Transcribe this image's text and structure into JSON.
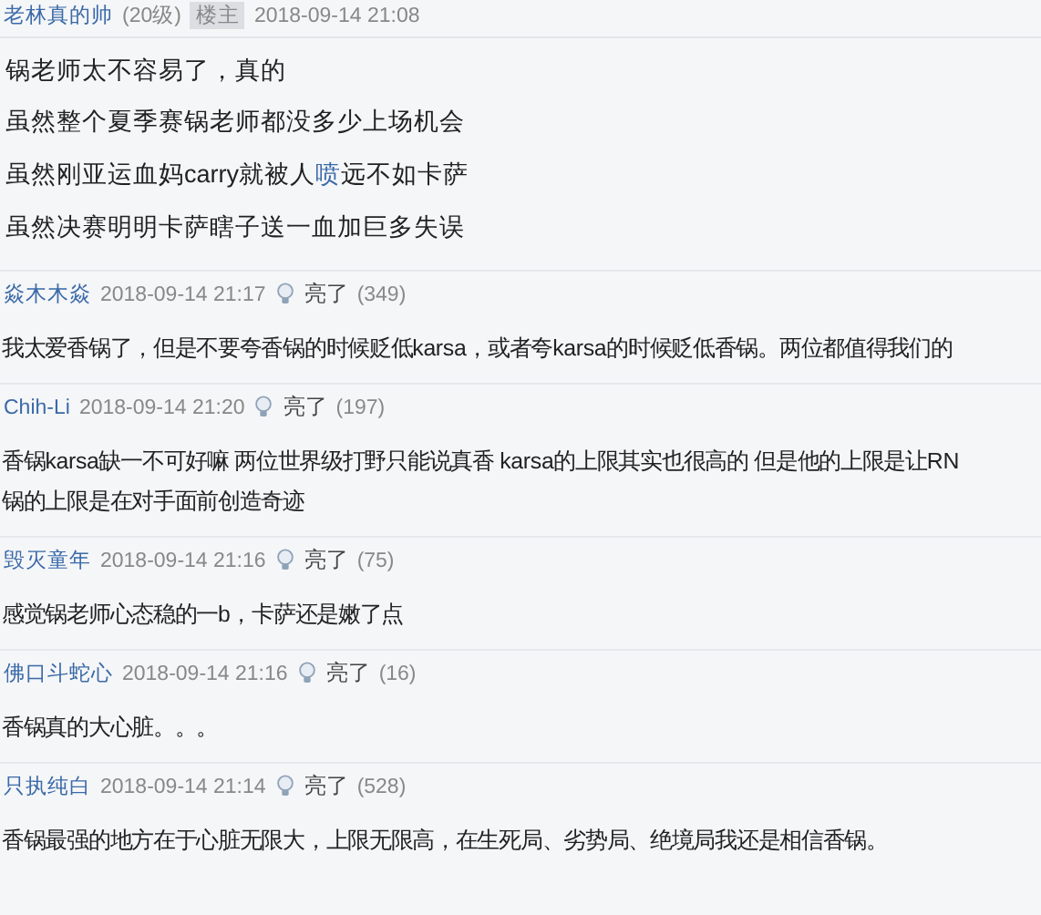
{
  "main_post": {
    "author": "老林真的帅",
    "level": "(20级)",
    "badge": "楼主",
    "time": "2018-09-14 21:08",
    "lines": [
      {
        "text": "锅老师太不容易了，真的"
      },
      {
        "text": "虽然整个夏季赛锅老师都没多少上场机会"
      },
      {
        "text": "虽然刚亚运血妈carry就被人",
        "link": "喷",
        "after": "远不如卡萨"
      },
      {
        "text": "虽然决赛明明卡萨瞎子送一血加巨多失误"
      }
    ]
  },
  "replies": [
    {
      "author": "焱木木焱",
      "time": "2018-09-14 21:17",
      "light": "亮了",
      "count": "(349)",
      "lines": [
        "我太爱香锅了，但是不要夸香锅的时候贬低karsa，或者夸karsa的时候贬低香锅。两位都值得我们的"
      ]
    },
    {
      "author": "Chih-Li",
      "time": "2018-09-14 21:20",
      "light": "亮了",
      "count": "(197)",
      "lines": [
        "香锅karsa缺一不可好嘛 两位世界级打野只能说真香 karsa的上限其实也很高的 但是他的上限是让RN",
        "锅的上限是在对手面前创造奇迹"
      ]
    },
    {
      "author": "毁灭童年",
      "time": "2018-09-14 21:16",
      "light": "亮了",
      "count": "(75)",
      "lines": [
        "感觉锅老师心态稳的一b，卡萨还是嫩了点"
      ]
    },
    {
      "author": "佛口斗蛇心",
      "time": "2018-09-14 21:16",
      "light": "亮了",
      "count": "(16)",
      "lines": [
        "香锅真的大心脏。。。"
      ]
    },
    {
      "author": "只执纯白",
      "time": "2018-09-14 21:14",
      "light": "亮了",
      "count": "(528)",
      "lines": [
        "香锅最强的地方在于心脏无限大，上限无限高，在生死局、劣势局、绝境局我还是相信香锅。"
      ]
    }
  ]
}
